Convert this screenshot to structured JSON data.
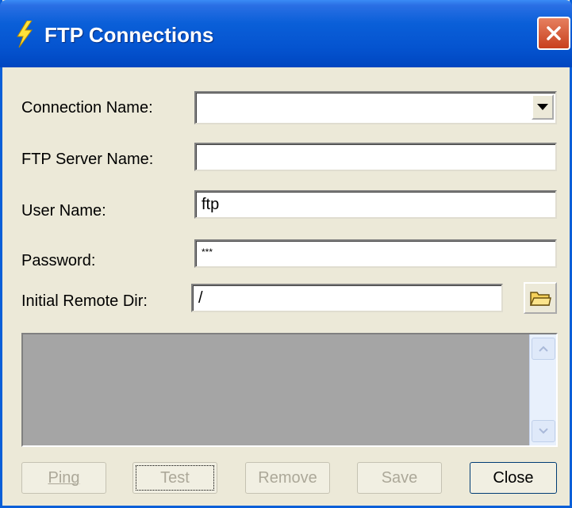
{
  "window": {
    "title": "FTP Connections"
  },
  "form": {
    "connection_name": {
      "label": "Connection Name:",
      "value": ""
    },
    "server_name": {
      "label": "FTP Server Name:",
      "value": ""
    },
    "user_name": {
      "label": "User Name:",
      "value": "ftp"
    },
    "password": {
      "label": "Password:",
      "value": "***"
    },
    "remote_dir": {
      "label": "Initial Remote Dir:",
      "value": "/"
    }
  },
  "buttons": {
    "ping": "Ping",
    "test": "Test",
    "remove": "Remove",
    "save": "Save",
    "close": "Close"
  },
  "colors": {
    "titlebar": "#0a5fd8",
    "window_bg": "#ece9d8",
    "log_bg": "#a5a5a5",
    "close_btn": "#d9552f"
  },
  "icons": {
    "app": "lightning-icon",
    "close": "close-icon",
    "dropdown": "chevron-down-icon",
    "browse": "folder-icon"
  }
}
